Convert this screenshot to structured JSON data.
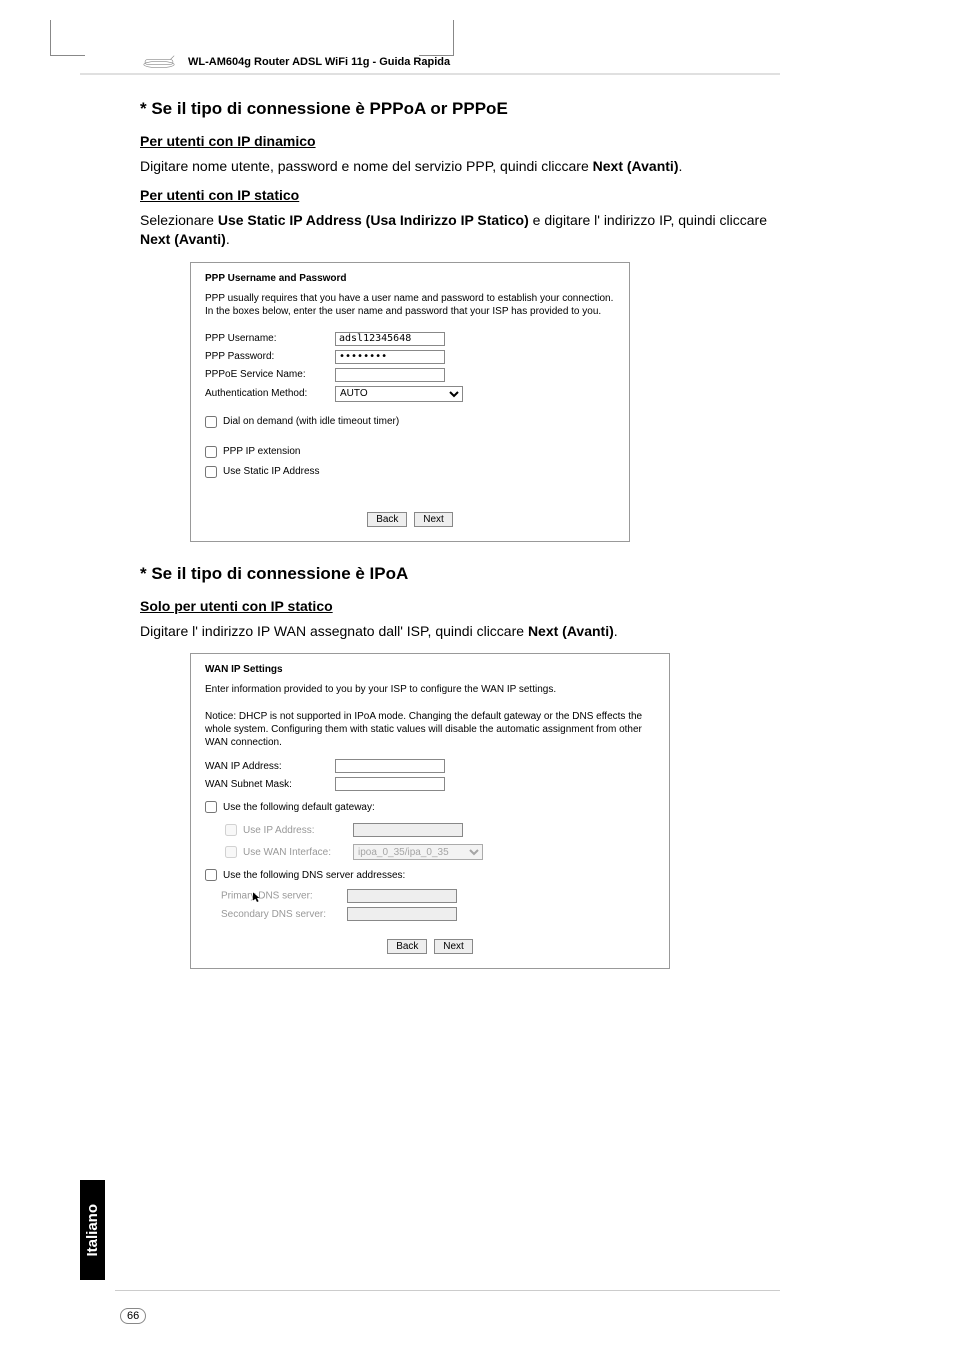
{
  "header": {
    "product_line": "WL-AM604g Router ADSL WiFi 11g - Guida Rapida"
  },
  "section1": {
    "heading": "* Se il tipo di connessione è PPPoA or PPPoE",
    "dyn_heading": "Per utenti con IP dinamico",
    "dyn_body_pre": "Digitare nome utente, password e nome del servizio PPP, quindi cliccare ",
    "dyn_body_bold": "Next (Avanti)",
    "dyn_body_post": ".",
    "stat_heading": "Per utenti con IP statico",
    "stat_body_pre": "Selezionare ",
    "stat_body_bold1": "Use Static IP Address (Usa Indirizzo IP Statico)",
    "stat_body_mid": " e digitare l' indirizzo IP, quindi cliccare ",
    "stat_body_bold2": "Next (Avanti)",
    "stat_body_post": "."
  },
  "ppp_box": {
    "title": "PPP Username and Password",
    "desc": "PPP usually requires that you have a user name and password to establish your connection. In the boxes below, enter the user name and password that your ISP has provided to you.",
    "username_label": "PPP Username:",
    "username_value": "adsl12345648",
    "password_label": "PPP Password:",
    "password_value": "••••••••",
    "service_label": "PPPoE Service Name:",
    "service_value": "",
    "auth_label": "Authentication Method:",
    "auth_value": "AUTO",
    "dial_on_demand": "Dial on demand (with idle timeout timer)",
    "ppp_ext": "PPP IP extension",
    "static_ip": "Use Static IP Address",
    "back": "Back",
    "next": "Next"
  },
  "section2": {
    "heading": "* Se il tipo di connessione è IPoA",
    "sub_heading": "Solo per utenti con IP statico",
    "body_pre": "Digitare l' indirizzo IP WAN assegnato dall' ISP, quindi cliccare ",
    "body_bold": "Next (Avanti)",
    "body_post": "."
  },
  "wan_box": {
    "title": "WAN IP Settings",
    "desc": "Enter information provided to you by your ISP to configure the WAN IP settings.",
    "notice": "Notice: DHCP is not supported in IPoA mode. Changing the default gateway or the DNS effects the whole system. Configuring them with static values will disable the automatic assignment from other WAN connection.",
    "wan_ip_label": "WAN IP Address:",
    "wan_mask_label": "WAN Subnet Mask:",
    "use_gw": "Use the following default gateway:",
    "use_ip": "Use IP Address:",
    "use_wan_if": "Use WAN Interface:",
    "wan_if_value": "ipoa_0_35/ipa_0_35",
    "use_dns": "Use the following DNS server addresses:",
    "primary_dns": "Primary DNS server:",
    "secondary_dns": "Secondary DNS server:",
    "back": "Back",
    "next": "Next"
  },
  "sidebar": "Italiano",
  "page_number": "66"
}
